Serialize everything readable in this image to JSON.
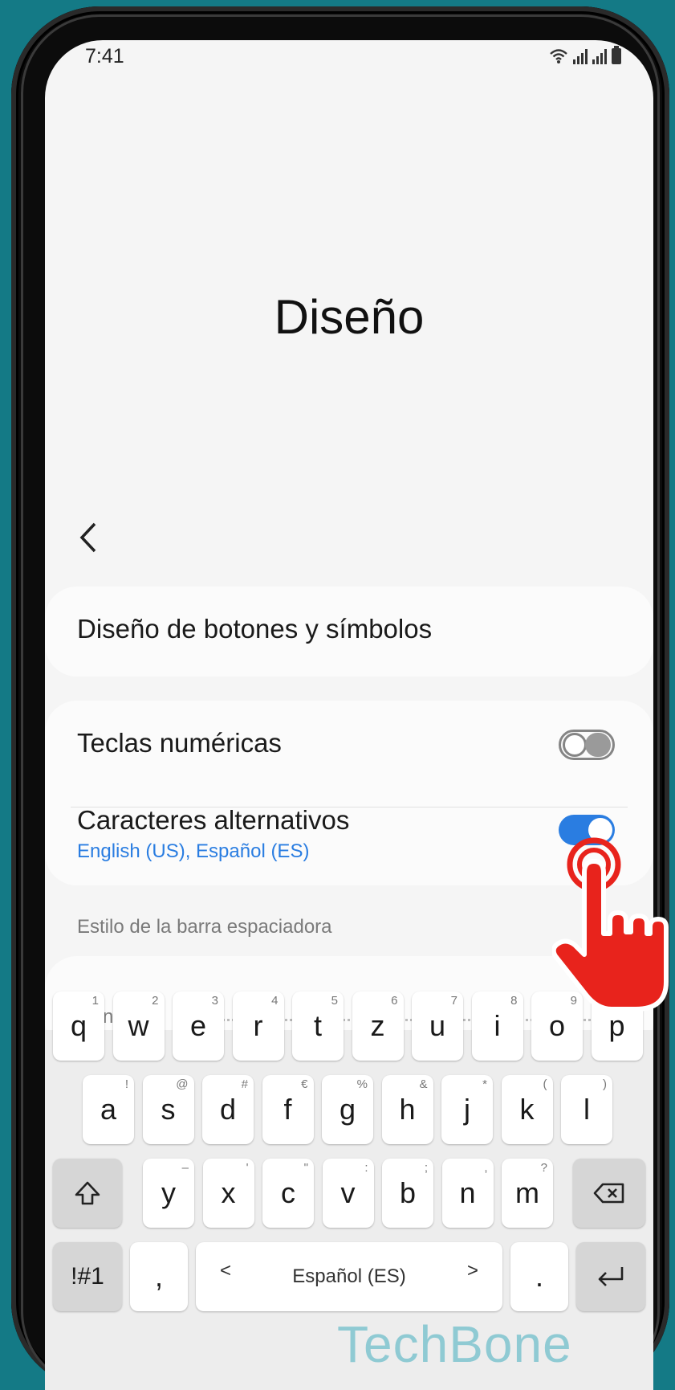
{
  "status": {
    "time": "7:41"
  },
  "header": {
    "title": "Diseño"
  },
  "settings": {
    "layout_symbols": "Diseño de botones y símbolos",
    "numeric_keys": {
      "label": "Teclas numéricas",
      "on": false
    },
    "alt_chars": {
      "label": "Caracteres alternativos",
      "sub": "English (US), Español (ES)",
      "on": true
    },
    "spacebar_section": "Estilo de la barra espaciadora",
    "spacebar_style": "General"
  },
  "keyboard": {
    "row1": [
      {
        "k": "q",
        "h": "1"
      },
      {
        "k": "w",
        "h": "2"
      },
      {
        "k": "e",
        "h": "3"
      },
      {
        "k": "r",
        "h": "4"
      },
      {
        "k": "t",
        "h": "5"
      },
      {
        "k": "z",
        "h": "6"
      },
      {
        "k": "u",
        "h": "7"
      },
      {
        "k": "i",
        "h": "8"
      },
      {
        "k": "o",
        "h": "9"
      },
      {
        "k": "p",
        "h": "0"
      }
    ],
    "row2": [
      {
        "k": "a",
        "h": "!"
      },
      {
        "k": "s",
        "h": "@"
      },
      {
        "k": "d",
        "h": "#"
      },
      {
        "k": "f",
        "h": "€"
      },
      {
        "k": "g",
        "h": "%"
      },
      {
        "k": "h",
        "h": "&"
      },
      {
        "k": "j",
        "h": "*"
      },
      {
        "k": "k",
        "h": "("
      },
      {
        "k": "l",
        "h": ")"
      }
    ],
    "row3": [
      {
        "k": "y",
        "h": "–"
      },
      {
        "k": "x",
        "h": "'"
      },
      {
        "k": "c",
        "h": "\""
      },
      {
        "k": "v",
        "h": ":"
      },
      {
        "k": "b",
        "h": ";"
      },
      {
        "k": "n",
        "h": ","
      },
      {
        "k": "m",
        "h": "?"
      }
    ],
    "symbols_key": "!#1",
    "comma_key": ",",
    "space_left": "<",
    "space_label": "Español (ES)",
    "space_right": ">",
    "period_key": "."
  },
  "watermark": "TechBone",
  "colors": {
    "accent": "#2a7de1",
    "background": "#147a86",
    "hand": "#e8231c"
  }
}
